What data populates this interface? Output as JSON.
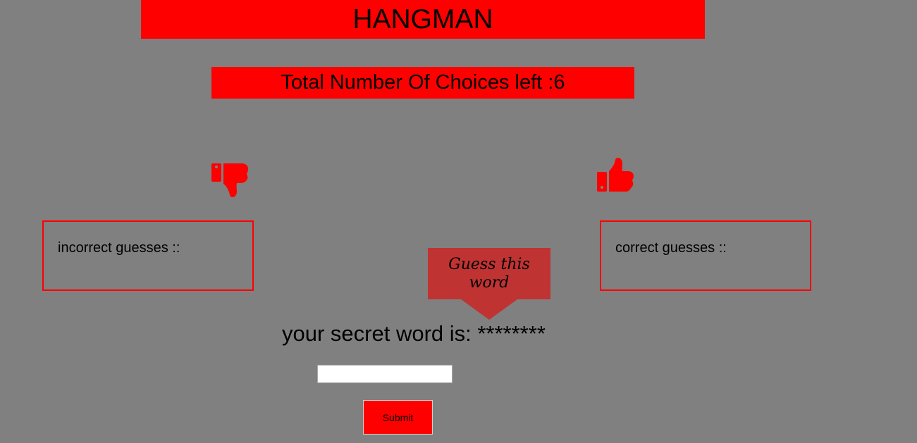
{
  "header": {
    "title": "HANGMAN"
  },
  "status": {
    "choices_left_text": "Total Number Of Choices left :6"
  },
  "incorrect_panel": {
    "label": "incorrect guesses ::"
  },
  "correct_panel": {
    "label": "correct guesses ::"
  },
  "hint_bubble": {
    "text": "Guess this word"
  },
  "secret": {
    "text": "your secret word is: ********"
  },
  "guess_form": {
    "input_value": "",
    "submit_label": "Submit"
  },
  "colors": {
    "background": "#808080",
    "accent": "#ff0000",
    "bubble": "#bf3333"
  },
  "icons": {
    "incorrect": "thumbs-down-icon",
    "correct": "thumbs-up-icon"
  }
}
